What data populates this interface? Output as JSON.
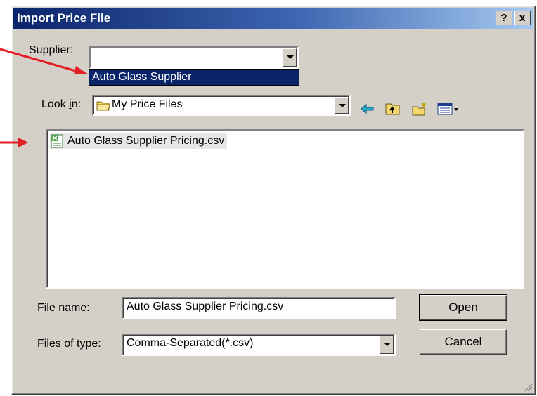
{
  "window": {
    "title": "Import Price File",
    "help_label": "?",
    "close_label": "x"
  },
  "supplier": {
    "label": "Supplier:",
    "value": "",
    "highlighted_option": "Auto Glass Supplier"
  },
  "look_in": {
    "label_pre": "Look ",
    "label_u": "i",
    "label_post": "n:",
    "value": "My Price Files",
    "folder_icon": "folder-icon"
  },
  "toolbar": {
    "icons": [
      "back-arrow-icon",
      "up-folder-icon",
      "new-folder-icon",
      "view-menu-icon"
    ]
  },
  "files": [
    {
      "name": "Auto Glass Supplier Pricing.csv",
      "icon": "csv-file-icon"
    }
  ],
  "file_name": {
    "label_pre": "File ",
    "label_u": "n",
    "label_post": "ame:",
    "value": "Auto Glass Supplier Pricing.csv"
  },
  "file_type": {
    "label_pre": "Files of ",
    "label_u": "t",
    "label_post": "ype:",
    "value": "Comma-Separated(*.csv)"
  },
  "buttons": {
    "open_u": "O",
    "open_rest": "pen",
    "cancel": "Cancel"
  },
  "colors": {
    "title_start": "#0a246a",
    "title_end": "#a6caf0",
    "dialog_bg": "#d4d0c8",
    "selection": "#0a246a",
    "annotation_arrow": "#e31e24"
  }
}
